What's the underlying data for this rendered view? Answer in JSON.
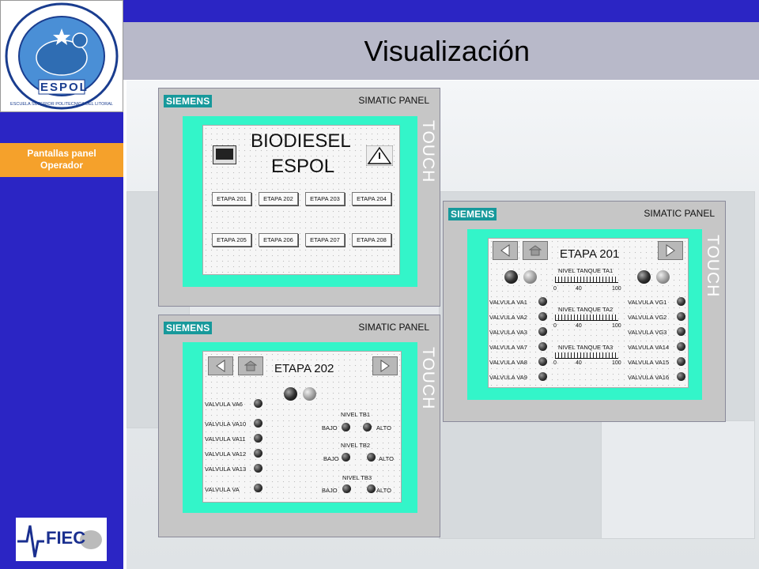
{
  "slide": {
    "title": "Visualización",
    "sidebar_tag_line1": "Pantallas panel",
    "sidebar_tag_line2": "Operador",
    "fiec_logo_text": "FIEC",
    "espol_logo_text": "ESPOL",
    "espol_logo_ring": "ESCUELA SUPERIOR POLITECNICA DEL LITORAL"
  },
  "panel_main": {
    "brand": "SIEMENS",
    "model": "SIMATIC PANEL",
    "touch": "TOUCH",
    "title_line1": "BIODIESEL",
    "title_line2": "ESPOL",
    "buttons": [
      "ETAPA 201",
      "ETAPA 202",
      "ETAPA 203",
      "ETAPA 204",
      "ETAPA 205",
      "ETAPA 206",
      "ETAPA 207",
      "ETAPA 208"
    ]
  },
  "panel_202": {
    "brand": "SIEMENS",
    "model": "SIMATIC PANEL",
    "touch": "TOUCH",
    "title": "ETAPA 202",
    "valves": [
      "VALVULA VA6",
      "VALVULA VA10",
      "VALVULA VA11",
      "VALVULA VA12",
      "VALVULA VA13",
      "VALVULA VA"
    ],
    "levels": [
      {
        "name": "NIVEL TB1",
        "low": "BAJO",
        "high": "ALTO"
      },
      {
        "name": "NIVEL TB2",
        "low": "BAJO",
        "high": "ALTO"
      },
      {
        "name": "NIVEL TB3",
        "low": "BAJO",
        "high": "ALTO"
      }
    ]
  },
  "panel_201": {
    "brand": "SIEMENS",
    "model": "SIMATIC PANEL",
    "touch": "TOUCH",
    "title": "ETAPA 201",
    "valves_left": [
      "VALVULA VA1",
      "VALVULA VA2",
      "VALVULA VA3",
      "VALVULA VA7",
      "VALVULA VA8",
      "VALVULA VA9"
    ],
    "valves_right": [
      "VALVULA VG1",
      "VALVULA VG2",
      "VALVULA VG3",
      "VALVULA VA14",
      "VALVULA VA15",
      "VALVULA VA16"
    ],
    "tanks": [
      {
        "name": "NIVEL TANQUE TA1",
        "t0": "0",
        "t1": "40",
        "t2": "100"
      },
      {
        "name": "NIVEL TANQUE TA2",
        "t0": "0",
        "t1": "40",
        "t2": "100"
      },
      {
        "name": "NIVEL TANQUE TA3",
        "t0": "0",
        "t1": "40",
        "t2": "100"
      }
    ]
  },
  "colors": {
    "sidebar": "#2b25c4",
    "accent_orange": "#f5a12b",
    "touch_frame": "#33f5c9",
    "siemens_teal": "#17999b"
  }
}
